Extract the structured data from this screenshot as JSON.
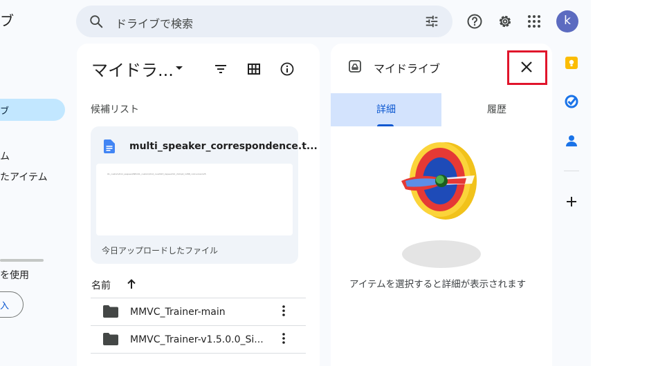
{
  "sidebar": {
    "title_fragment": "ブ",
    "active_item_fragment": "ブ",
    "item_fragment_1": "ム",
    "item_fragment_2": "たアイテム",
    "storage_fragment": "を使用",
    "buy_fragment": "入"
  },
  "search": {
    "placeholder": "ドライブで検索",
    "icon": "search-icon",
    "filter_icon": "tune-icon"
  },
  "header_icons": [
    "help-icon",
    "settings-icon",
    "apps-icon"
  ],
  "account": {
    "initial": "k"
  },
  "main": {
    "title": "マイドラ...",
    "suggested_label": "候補リスト",
    "suggested_file": {
      "name": "multi_speaker_correspondence.t...",
      "preview_text": "01_custom/011_ssspeed/Nfm01_custom/012_cus2023_zspeed/12_ctxtopt_1288_cxinvoicex125",
      "reason": "今日アップロードしたファイル"
    },
    "column_name": "名前",
    "files": [
      {
        "name": "MMVC_Trainer-main"
      },
      {
        "name": "MMVC_Trainer-v1.5.0.0_Si..."
      }
    ]
  },
  "details": {
    "title": "マイドライブ",
    "tabs": [
      {
        "label": "詳細",
        "active": true
      },
      {
        "label": "履歴",
        "active": false
      }
    ],
    "empty_message": "アイテムを選択すると詳細が表示されます"
  },
  "colors": {
    "accent": "#0b57d0",
    "highlight_box": "#e0142b",
    "active_tab": "#d3e3fd"
  }
}
